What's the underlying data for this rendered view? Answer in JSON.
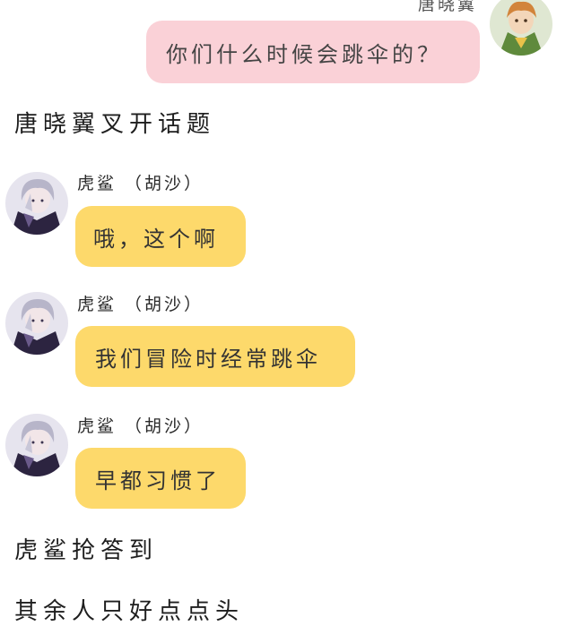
{
  "colors": {
    "self_bubble": "#fad1d7",
    "other_bubble": "#fdd96b",
    "background": "#ffffff"
  },
  "messages": [
    {
      "sender": "唐晓翼",
      "side": "right",
      "avatar_icon": "green-cloak-boy-avatar-icon",
      "text": "你们什么时候会跳伞的？"
    },
    {
      "sender": "虎鲨 （胡沙）",
      "side": "left",
      "avatar_icon": "silver-hair-boy-avatar-icon",
      "text": "哦，这个啊"
    },
    {
      "sender": "虎鲨 （胡沙）",
      "side": "left",
      "avatar_icon": "silver-hair-boy-avatar-icon",
      "text": "我们冒险时经常跳伞"
    },
    {
      "sender": "虎鲨 （胡沙）",
      "side": "left",
      "avatar_icon": "silver-hair-boy-avatar-icon",
      "text": "早都习惯了"
    }
  ],
  "narration": [
    "唐晓翼叉开话题",
    "虎鲨抢答到",
    "其余人只好点点头"
  ]
}
